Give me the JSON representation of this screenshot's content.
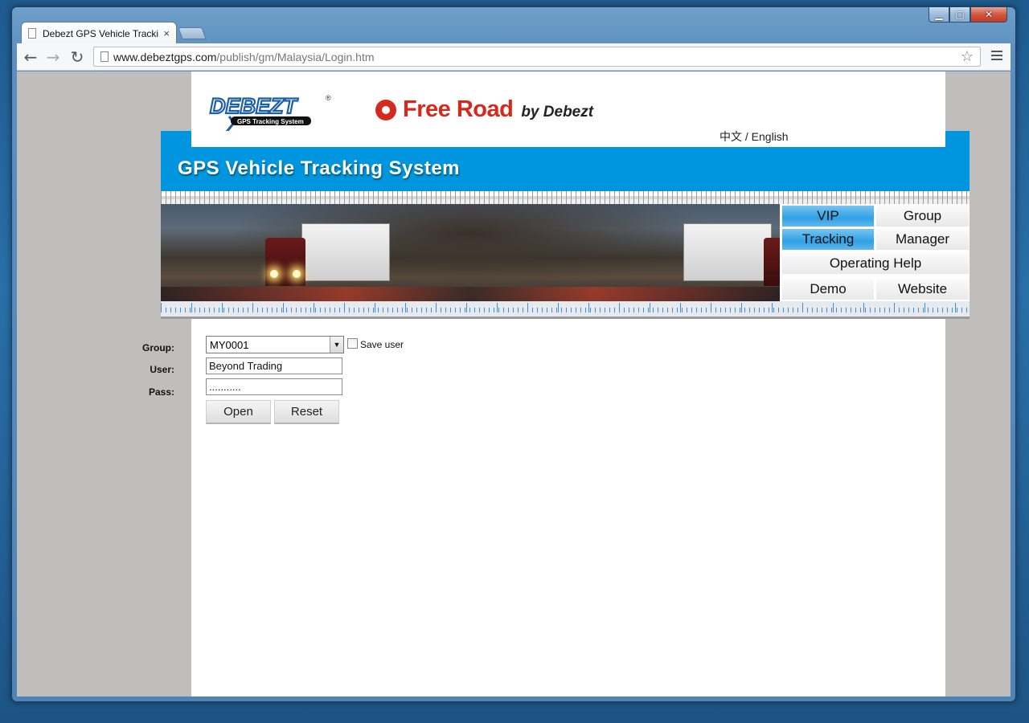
{
  "browser": {
    "tab_title": "Debezt GPS Vehicle Tracki",
    "tab_close": "×",
    "url_host": "www.debeztgps.com",
    "url_path": "/publish/gm/Malaysia/Login.htm"
  },
  "header": {
    "logo_text": "DEBEZT",
    "logo_tagline": "GPS Tracking System",
    "brand_main": "Free Road",
    "brand_by": "by Debezt",
    "language": "中文 / English",
    "system_title": "GPS Vehicle Tracking System"
  },
  "nav": {
    "vip": "VIP",
    "group": "Group",
    "tracking": "Tracking",
    "manager": "Manager",
    "operating_help": "Operating Help",
    "demo": "Demo",
    "website": "Website"
  },
  "form": {
    "group_label": "Group:",
    "group_value": "MY0001",
    "save_user_label": "Save user",
    "user_label": "User:",
    "user_value": "Beyond Trading",
    "pass_label": "Pass:",
    "pass_value": "...........",
    "open_button": "Open",
    "reset_button": "Reset"
  },
  "colors": {
    "header_blue": "#0096df",
    "brand_red": "#d42a1e",
    "active_nav": "#2ea1e6"
  }
}
